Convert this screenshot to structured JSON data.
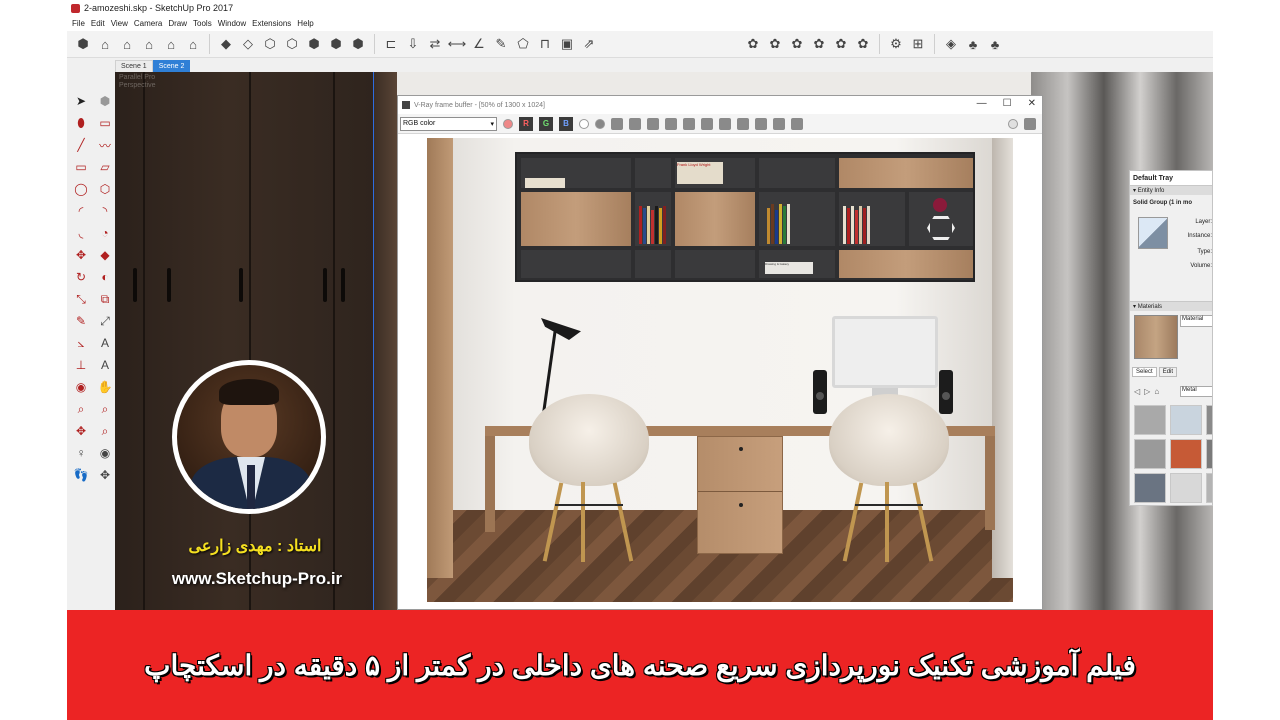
{
  "window": {
    "title": "2-amozeshi.skp - SketchUp Pro 2017"
  },
  "menu": [
    "File",
    "Edit",
    "View",
    "Camera",
    "Draw",
    "Tools",
    "Window",
    "Extensions",
    "Help"
  ],
  "scenes": [
    {
      "label": "Scene 1",
      "active": false
    },
    {
      "label": "Scene 2",
      "active": true
    }
  ],
  "viewport": {
    "label_line1": "Parallel Pro",
    "label_line2": "Perspective"
  },
  "vray": {
    "title": "V-Ray frame buffer - [50% of 1300 x 1024]",
    "channel": "RGB color",
    "buttons": [
      "R",
      "G",
      "B"
    ]
  },
  "render": {
    "book_labels": [
      "Frank Lloyd Wright",
      "Drawing & Galaxy"
    ]
  },
  "tray": {
    "title": "Default Tray",
    "entity_info_header": "Entity Info",
    "entity_type": "Solid Group (1 in mo",
    "labels": {
      "layer": "Layer:",
      "instance": "Instance:",
      "type": "Type:",
      "volume": "Volume:"
    },
    "materials_header": "Materials",
    "material_name": "Material",
    "tabs": [
      "Select",
      "Edit"
    ],
    "library": "Metal"
  },
  "overlay": {
    "instructor": "استاد : مهدی زارعی",
    "website": "www.Sketchup-Pro.ir",
    "banner": "فیلم آموزشی تکنیک نورپردازی سریع صحنه های داخلی در کمتر از ۵ دقیقه در اسکتچاپ"
  },
  "colors": {
    "banner": "#ec2424",
    "name_yellow": "#f5e020",
    "scene_active": "#2f7fd6"
  }
}
